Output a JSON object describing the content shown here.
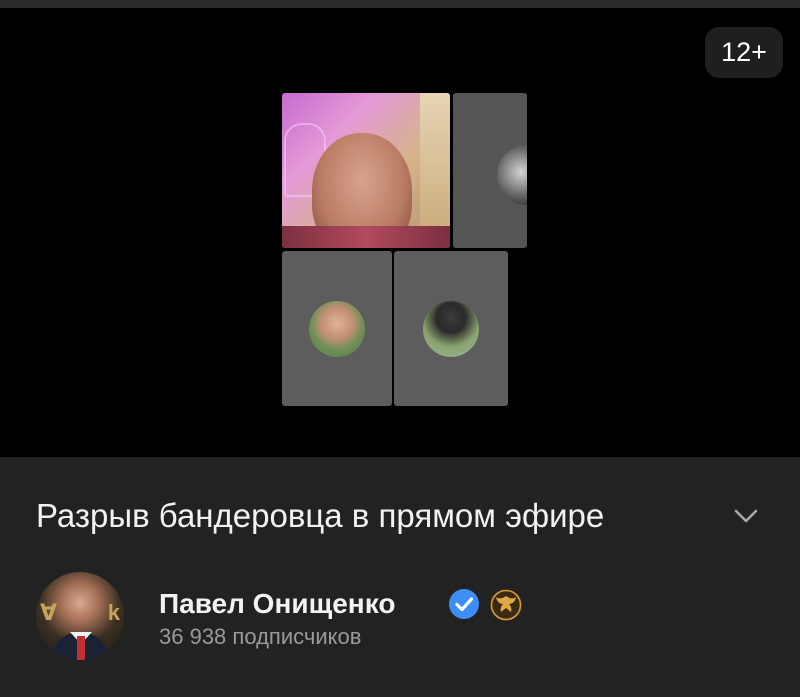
{
  "video": {
    "age_rating": "12+",
    "participants": [
      {
        "name": "participant-main"
      },
      {
        "name": "participant-right"
      },
      {
        "name": "participant-bottom-left"
      },
      {
        "name": "participant-bottom-right"
      }
    ]
  },
  "stream": {
    "title": "Разрыв бандеровца в прямом эфире"
  },
  "channel": {
    "name": "Павел Онищенко",
    "subscribers": "36 938 подписчиков",
    "verified": true,
    "verified_color": "#3e8ef7",
    "emblem_color": "#d39a3c"
  },
  "icons": {
    "expand": "chevron-down-icon",
    "verified": "verified-check-icon",
    "emblem": "eagle-emblem-icon"
  }
}
